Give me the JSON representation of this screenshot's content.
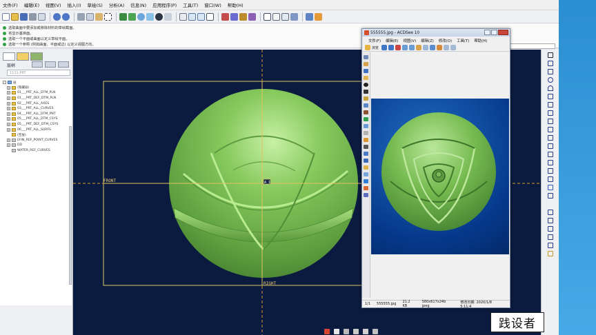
{
  "app": {
    "menu": [
      "文件(F)",
      "编辑(E)",
      "视图(V)",
      "插入(I)",
      "草绘(S)",
      "分析(A)",
      "信息(N)",
      "应用程序(P)",
      "工具(T)",
      "窗口(W)",
      "帮助(H)"
    ]
  },
  "messages": [
    "选取曲面中要添加或移除材料的草绘截面。",
    "将显示基准面。",
    "选取一个平面或曲面以定义草绘平面。",
    "选取一个参照 (例如曲面、平面或边) 以定义视图方向。"
  ],
  "left_panel": {
    "title": "层树",
    "filter_placeholder": "1111.PRT",
    "tree": [
      {
        "label": "层",
        "level": 0,
        "icon": "layer-root-icon",
        "expand": "-"
      },
      {
        "label": "(隐藏层)",
        "level": 1,
        "icon": "folder-icon",
        "expand": "+"
      },
      {
        "label": "01___PRT_ALL_DTM_PLN",
        "level": 1,
        "icon": "folder-icon",
        "expand": "+"
      },
      {
        "label": "01___PRT_DEF_DTM_PLN",
        "level": 1,
        "icon": "folder-icon",
        "expand": "+"
      },
      {
        "label": "02___PRT_ALL_AXES",
        "level": 1,
        "icon": "folder-icon",
        "expand": "+"
      },
      {
        "label": "03___PRT_ALL_CURVES",
        "level": 1,
        "icon": "folder-icon",
        "expand": "+"
      },
      {
        "label": "04___PRT_ALL_DTM_PNT",
        "level": 1,
        "icon": "folder-icon",
        "expand": "+"
      },
      {
        "label": "05___PRT_ALL_DTM_CSYS",
        "level": 1,
        "icon": "folder-icon",
        "expand": "+"
      },
      {
        "label": "05___PRT_DEF_DTM_CSYS",
        "level": 1,
        "icon": "folder-icon",
        "expand": "+"
      },
      {
        "label": "06___PRT_ALL_SURFS",
        "level": 1,
        "icon": "folder-icon",
        "expand": "+"
      },
      {
        "label": "(空层)",
        "level": 1,
        "icon": "folder-icon",
        "expand": ""
      },
      {
        "label": "EFIN_REF_POINT_CURVES",
        "level": 1,
        "icon": "layer-icon",
        "expand": "+"
      },
      {
        "label": "DD",
        "level": 1,
        "icon": "layer-icon",
        "expand": "+"
      },
      {
        "label": "WATER_REF_CURVES",
        "level": 1,
        "icon": "layer-icon",
        "expand": ""
      }
    ]
  },
  "viewport": {
    "label_front": "FRONT",
    "label_right": "RIGHT",
    "label_axis": "A_1",
    "colors": {
      "background": "#0b1b3f",
      "model": "#7cbf55",
      "plane": "#e0c46a",
      "dashed": "#d89a2c"
    }
  },
  "acdsee": {
    "title": "555555.jpg - ACDSee 10",
    "menu": [
      "文件(F)",
      "编辑(E)",
      "视图(V)",
      "编辑(Z)",
      "修改(O)",
      "工具(T)",
      "帮助(H)"
    ],
    "tool_label": "浏览",
    "status": {
      "page": "1/1",
      "filename": "555555.jpg",
      "size": "21.2 KB",
      "dims": "580x617x24b jpeg",
      "date": "修改日期: 2020/1/8 5:11:4"
    }
  },
  "watermark": "践设者"
}
